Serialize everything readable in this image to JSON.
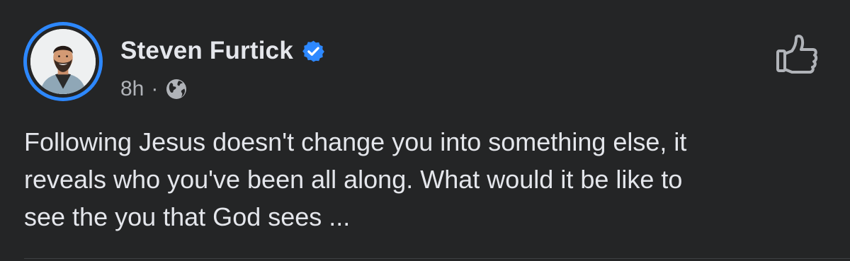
{
  "post": {
    "author": "Steven Furtick",
    "verified": true,
    "timestamp": "8h",
    "separator": "·",
    "audience_icon": "globe-icon",
    "text": "Following Jesus doesn't change you into something else, it\nreveals who you've been all along. What would it be like to\nsee the you that God sees ...",
    "like_icon": "thumbs-up-icon"
  },
  "colors": {
    "background": "#242526",
    "primary_text": "#e4e6eb",
    "secondary_text": "#b0b3b8",
    "accent": "#2d88ff"
  }
}
